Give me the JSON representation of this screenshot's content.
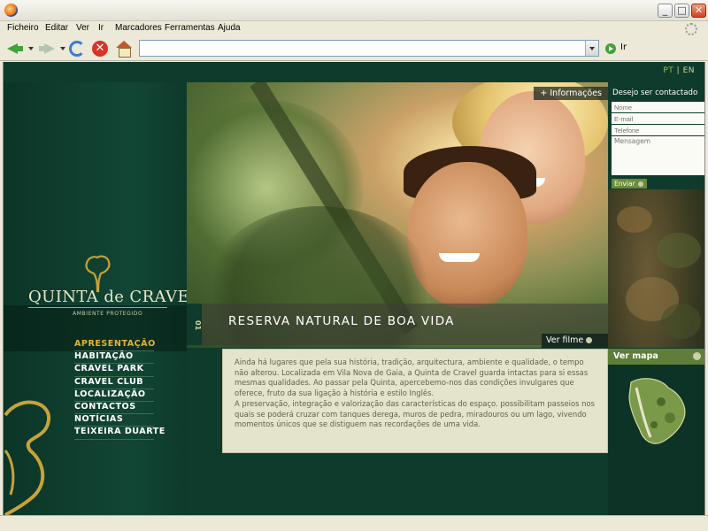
{
  "browser": {
    "menu": [
      "Ficheiro",
      "Editar",
      "Ver",
      "Ir",
      "Marcadores",
      "Ferramentas",
      "Ajuda"
    ],
    "url": "",
    "go_label": "Ir",
    "win_buttons": {
      "minimize": "_",
      "maximize": "□",
      "close": "✕"
    },
    "stop_glyph": "✕",
    "icons": [
      "back-icon",
      "forward-icon",
      "reload-icon",
      "stop-icon",
      "home-icon",
      "go-icon"
    ]
  },
  "site": {
    "lang": {
      "pt": "PT",
      "sep": "|",
      "en": "EN"
    },
    "logo": {
      "name": "QUINTA de CRAVEL",
      "mark": "®",
      "tagline": "AMBIENTE PROTEGIDO"
    },
    "menu": [
      {
        "label": "APRESENTAÇÃO",
        "active": true
      },
      {
        "label": "HABITAÇÃO",
        "active": false
      },
      {
        "label": "CRAVEL PARK",
        "active": false
      },
      {
        "label": "CRAVEL CLUB",
        "active": false
      },
      {
        "label": "LOCALIZAÇÃO",
        "active": false
      },
      {
        "label": "CONTACTOS",
        "active": false
      },
      {
        "label": "NOTÍCIAS",
        "active": false
      },
      {
        "label": "TEIXEIRA DUARTE",
        "active": false
      }
    ],
    "hero": {
      "number": "01",
      "title": "RESERVA NATURAL DE BOA VIDA",
      "info_label": "Informações",
      "info_prefix": "+",
      "film_label": "Ver filme"
    },
    "intro_text": "Ainda há lugares que pela sua história, tradição, arquitectura, ambiente e qualidade, o tempo não alterou. Localizada em Vila Nova de Gaia, a Quinta de Cravel guarda intactas para si essas mesmas qualidades. Ao passar pela Quinta, apercebemo-nos das condições invulgares que oferece, fruto da sua ligação à história e estilo Inglês.\nA preservação, integração e valorização das características do espaço. possibilitam passeios nos quais se poderá cruzar com tanques derega, muros de pedra, miradouros ou um lago, vivendo momentos únicos que se distiguem nas recordações de uma vida.",
    "contact": {
      "title": "Desejo ser contactado",
      "fields": {
        "name": "Nome",
        "email": "E-mail",
        "phone": "Telefone",
        "message": "Mensagem"
      },
      "send_label": "Enviar"
    },
    "map": {
      "label": "Ver mapa"
    },
    "colors": {
      "dark_green": "#0f3b2c",
      "gold": "#e0b33a",
      "olive": "#5e7e3a",
      "cream": "#e4e3cb"
    }
  }
}
